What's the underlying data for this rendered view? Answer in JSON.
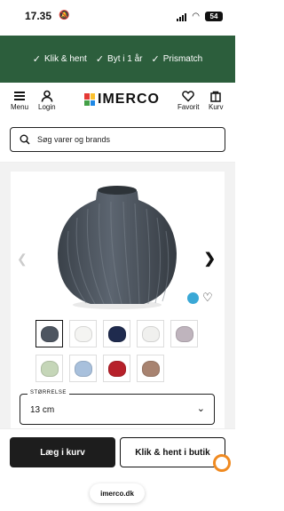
{
  "status_bar": {
    "time": "17.35",
    "battery": "54"
  },
  "promo": [
    {
      "label": "Klik & hent"
    },
    {
      "label": "Byt i 1 år"
    },
    {
      "label": "Prismatch"
    }
  ],
  "header": {
    "menu_label": "Menu",
    "login_label": "Login",
    "logo_text": "IMERCO",
    "favorit_label": "Favorit",
    "cart_label": "Kurv"
  },
  "search": {
    "placeholder": "Søg varer og brands"
  },
  "product": {
    "main_vase_color": "#4d5560",
    "thumbnails": [
      {
        "color": "#4d5560",
        "active": true
      },
      {
        "color": "#f4f4f2",
        "active": false
      },
      {
        "color": "#1f2b4e",
        "active": false
      },
      {
        "color": "#f0f0ee",
        "active": false
      },
      {
        "color": "#bfb4bd",
        "active": false
      },
      {
        "color": "#c5d6b8",
        "active": false
      },
      {
        "color": "#a8c0dc",
        "active": false
      },
      {
        "color": "#b7202a",
        "active": false
      },
      {
        "color": "#a88370",
        "active": false
      }
    ],
    "size_label": "STØRRELSE",
    "size_value": "13 cm"
  },
  "cta": {
    "add_to_cart": "Læg i kurv",
    "click_collect": "Klik & hent i butik"
  },
  "url": "imerco.dk"
}
